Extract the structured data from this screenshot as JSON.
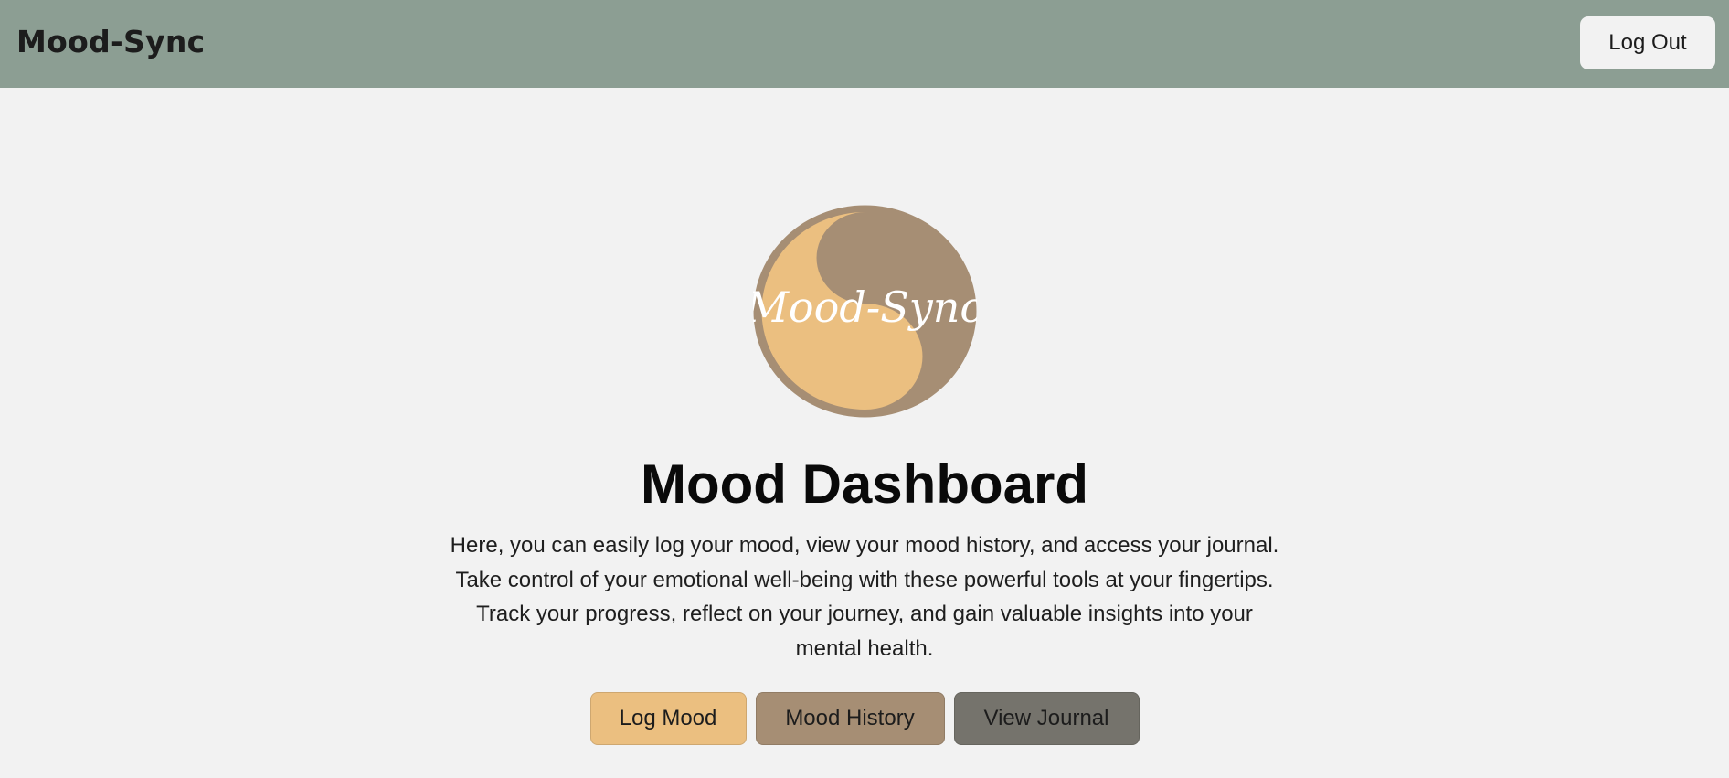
{
  "header": {
    "brand": "Mood-Sync",
    "logout_label": "Log Out"
  },
  "logo": {
    "text": "Mood-Sync",
    "colors": {
      "light": "#ebbf80",
      "dark": "#a68e74"
    }
  },
  "main": {
    "title": "Mood Dashboard",
    "description": "Here, you can easily log your mood, view your mood history, and access your journal. Take control of your emotional well-being with these powerful tools at your fingertips. Track your progress, reflect on your journey, and gain valuable insights into your mental health.",
    "actions": {
      "log_mood": "Log Mood",
      "mood_history": "Mood History",
      "view_journal": "View Journal"
    }
  },
  "theme": {
    "header_bg": "#8c9e93",
    "page_bg": "#f2f2f2",
    "log_mood_bg": "#ebbf80",
    "mood_history_bg": "#a68e74",
    "view_journal_bg": "#75736c"
  }
}
